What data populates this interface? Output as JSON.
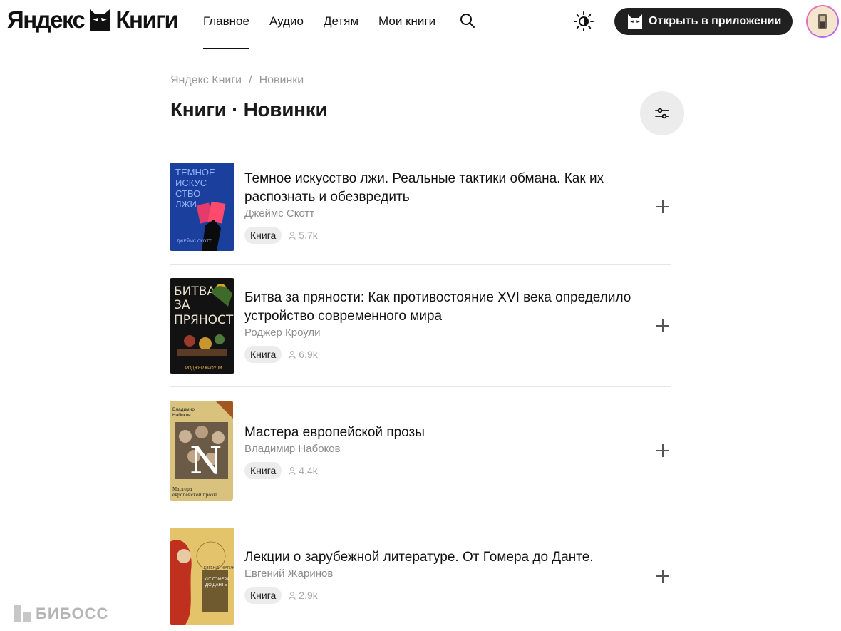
{
  "header": {
    "logo_left": "Яндекс",
    "logo_right": "Книги",
    "nav": [
      {
        "label": "Главное",
        "active": true
      },
      {
        "label": "Аудио",
        "active": false
      },
      {
        "label": "Детям",
        "active": false
      },
      {
        "label": "Мои книги",
        "active": false
      }
    ],
    "open_app_label": "Открыть в приложении"
  },
  "breadcrumb": {
    "root": "Яндекс Книги",
    "separator": "/",
    "current": "Новинки"
  },
  "page_title": "Книги · Новинки",
  "books": [
    {
      "title": "Темное искусство лжи. Реальные тактики обмана. Как их распознать и обезвредить",
      "author": "Джеймс Скотт",
      "type": "Книга",
      "readers": "5.7k",
      "cover_text": "ТЕМНОЕ ИСКУС СТВО ЛЖИ",
      "cover_color": "#1b3f9c"
    },
    {
      "title": "Битва за пряности: Как противостояние XVI века определило устройство современного мира",
      "author": "Роджер Кроули",
      "type": "Книга",
      "readers": "6.9k",
      "cover_text": "БИТВА ЗА ПРЯНОСТИ",
      "cover_color": "#121212"
    },
    {
      "title": "Мастера европейской прозы",
      "author": "Владимир Набоков",
      "type": "Книга",
      "readers": "4.4k",
      "cover_text": "Владимир Набоков",
      "cover_color": "#d9c27e"
    },
    {
      "title": "Лекции о зарубежной литературе. От Гомера до Данте.",
      "author": "Евгений Жаринов",
      "type": "Книга",
      "readers": "2.9k",
      "cover_text": "ОТ ГОМЕРА ДО ДАНТЕ",
      "cover_color": "#e4c46a"
    }
  ],
  "watermark": "БИБОСС",
  "colors": {
    "accent_dark": "#202020",
    "muted_text": "#8c8c8c",
    "badge_bg": "#ececec"
  }
}
